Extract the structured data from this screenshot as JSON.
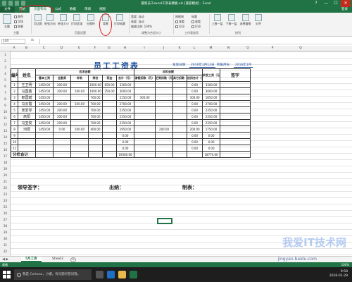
{
  "window": {
    "title": "最新员工excel工资表模板.xls [兼容模式] - Excel",
    "controls": [
      "?",
      "—",
      "☐",
      "✕"
    ]
  },
  "ribbon": {
    "tabs": [
      "文件",
      "开始",
      "页面布局",
      "公式",
      "数据",
      "审阅",
      "视图"
    ],
    "active_tab": "页面布局",
    "login": "登录",
    "groups": {
      "themes": "主题",
      "page_setup": "页面设置",
      "scale_to_fit": "调整为合适大小",
      "sheet_options": "工作表选项",
      "arrange": "排列"
    },
    "buttons": {
      "themes": "主题",
      "colors": "颜色",
      "fonts": "字体",
      "effects": "效果",
      "margins": "页边距",
      "orientation": "纸张方向",
      "size": "纸张大小",
      "print_area": "打印区域",
      "breaks": "分隔符",
      "background": "背景",
      "print_titles": "打印标题",
      "width": "宽度",
      "width_value": "自动",
      "height": "高度",
      "height_value": "自动",
      "scale": "缩放比例",
      "scale_value": "100%",
      "gridlines": "网格线",
      "headings": "标题",
      "view": "查看",
      "print": "打印",
      "bring_forward": "上移一层",
      "send_backward": "下移一层",
      "selection_pane": "选择窗格",
      "align": "对齐"
    }
  },
  "formula_bar": {
    "name_box": "J24",
    "fx": "fx",
    "content": ""
  },
  "grid": {
    "columns": [
      "A",
      "B",
      "C",
      "D",
      "E",
      "F",
      "G",
      "H",
      "I",
      "J",
      "K",
      "L",
      "M",
      "N",
      "O",
      "P",
      "Q"
    ],
    "rows": [
      "1",
      "2",
      "3",
      "4",
      "5",
      "6",
      "7",
      "8",
      "9",
      "10",
      "11",
      "12",
      "13",
      "14",
      "15",
      "16",
      "17",
      "18",
      "19",
      "20",
      "21",
      "22",
      "23",
      "24",
      "25",
      "26",
      "27",
      "28",
      "29",
      "30",
      "31",
      "32"
    ]
  },
  "document": {
    "title": "员工工资表",
    "meta_label_1": "发放日期：",
    "meta_date": "2016年1月12日",
    "meta_label_2": "所属月份：",
    "meta_month": "2016年1月",
    "header": {
      "num": "编号",
      "name": "姓名",
      "payable_group": "应发金额",
      "deduct_group": "应扣金额",
      "basic": "基本工资",
      "allowance": "全勤奖",
      "subsidy": "补助",
      "bonus_post": "岗位",
      "bonus": "奖金",
      "subtotal1": "合计（元）",
      "late": "请假扣款（元）",
      "absent": "迟到扣款（元）",
      "other": "其它扣款（元）",
      "subtotal2": "应扣合计（元）",
      "actual": "实发工资（元）",
      "sign": "签字"
    },
    "rows": [
      {
        "no": "1",
        "name": "王卫明",
        "c": [
          "1450.00",
          "200.00",
          "",
          "1000.00",
          "650.00",
          "3300.00",
          "",
          "",
          "",
          "0.00",
          "3300.00"
        ]
      },
      {
        "no": "2",
        "name": "马国鑫",
        "c": [
          "1450.00",
          "200.00",
          "100.00",
          "1000.00",
          "250.00",
          "3000.00",
          "",
          "",
          "",
          "0.00",
          "3000.00"
        ]
      },
      {
        "no": "3",
        "name": "郎国斌",
        "c": [
          "1450.00",
          "",
          "",
          "700.00",
          "",
          "2150.00",
          "300.00",
          "",
          "",
          "300.00",
          "1850.00"
        ]
      },
      {
        "no": "4",
        "name": "马云霞",
        "c": [
          "1450.00",
          "200.00",
          "350.00",
          "700.00",
          "",
          "2700.00",
          "",
          "",
          "",
          "0.00",
          "2700.00"
        ]
      },
      {
        "no": "5",
        "name": "张爱琴",
        "c": [
          "1450.00",
          "200.00",
          "",
          "700.00",
          "",
          "2350.00",
          "",
          "",
          "",
          "0.00",
          "2350.00"
        ]
      },
      {
        "no": "6",
        "name": "高阳",
        "c": [
          "1450.00",
          "200.00",
          "",
          "700.00",
          "",
          "2350.00",
          "",
          "",
          "",
          "0.00",
          "2350.00"
        ]
      },
      {
        "no": "7",
        "name": "马亚俊",
        "c": [
          "1450.00",
          "200.00",
          "",
          "700.00",
          "",
          "2350.00",
          "",
          "",
          "",
          "0.00",
          "2350.00"
        ]
      },
      {
        "no": "8",
        "name": "河源",
        "c": [
          "1450.00",
          "0.00",
          "100.00",
          "400.00",
          "",
          "1950.00",
          "",
          "200.00",
          "",
          "200.00",
          "1750.00"
        ]
      },
      {
        "no": "9",
        "name": "",
        "c": [
          "",
          "",
          "",
          "",
          "",
          "0.00",
          "",
          "",
          "",
          "0.00",
          "0.00"
        ]
      },
      {
        "no": "10",
        "name": "",
        "c": [
          "",
          "",
          "",
          "",
          "",
          "0.00",
          "",
          "",
          "",
          "0.00",
          "0.00"
        ]
      },
      {
        "no": "11",
        "name": "",
        "c": [
          "",
          "",
          "",
          "",
          "",
          "0.00",
          "",
          "",
          "",
          "0.00",
          "0.00"
        ]
      }
    ],
    "total_row": {
      "label": "分栏合计",
      "subtotal1": "19300.00",
      "actual": "18770.00"
    },
    "signature_leader": "领导签字：",
    "signature_cashier": "出纳：",
    "signature_maker": "制表："
  },
  "sheets": {
    "tabs": [
      "5月工资",
      "Sheet3"
    ],
    "active": "5月工资",
    "add": "+"
  },
  "statusbar": {
    "ready": "就绪",
    "zoom": "100%"
  },
  "taskbar": {
    "search_placeholder": "我是 Cortana，小娜。有问题尽管问我。",
    "time": "9:58",
    "date": "2016-01-29"
  },
  "watermark": {
    "main": "我爱IT技术网",
    "sub": "jingyan.baidu.com"
  },
  "colors": {
    "excel_green": "#217346",
    "annotation_red": "#e02020",
    "title_blue": "#1a4c9c"
  }
}
